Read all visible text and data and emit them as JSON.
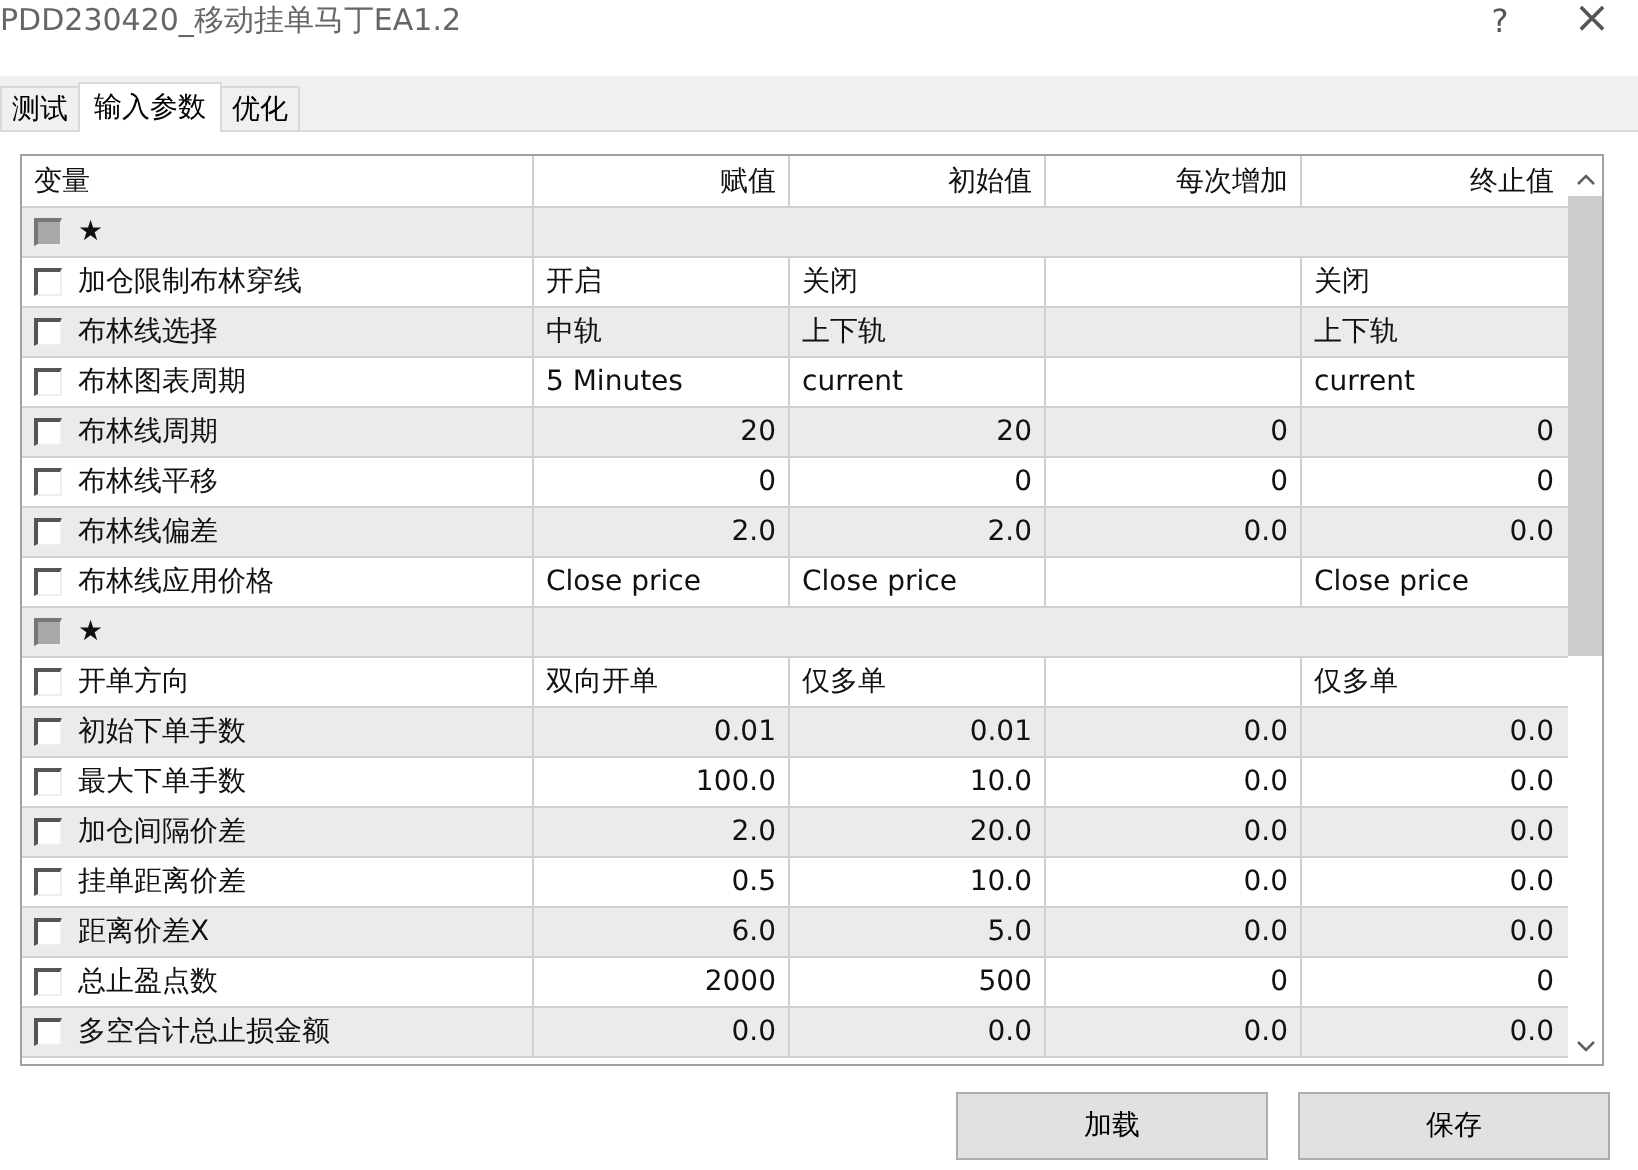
{
  "window": {
    "title": "PDD230420_移动挂单马丁EA1.2",
    "help": "?",
    "close": "×"
  },
  "tabs": [
    {
      "label": "测试",
      "selected": false
    },
    {
      "label": "输入参数",
      "selected": true
    },
    {
      "label": "优化",
      "selected": false
    }
  ],
  "table": {
    "columns": [
      "变量",
      "赋值",
      "初始值",
      "每次增加",
      "终止值"
    ],
    "rows": [
      {
        "kind": "group",
        "checked": false,
        "cells": [
          "★",
          "",
          "",
          "",
          ""
        ]
      },
      {
        "kind": "text",
        "checked": false,
        "cells": [
          "加仓限制布林穿线",
          "开启",
          "关闭",
          "",
          "关闭"
        ]
      },
      {
        "kind": "text",
        "checked": false,
        "cells": [
          "布林线选择",
          "中轨",
          "上下轨",
          "",
          "上下轨"
        ]
      },
      {
        "kind": "text",
        "checked": false,
        "cells": [
          "布林图表周期",
          "5 Minutes",
          "current",
          "",
          "current"
        ]
      },
      {
        "kind": "number",
        "checked": false,
        "cells": [
          "布林线周期",
          "20",
          "20",
          "0",
          "0"
        ]
      },
      {
        "kind": "number",
        "checked": false,
        "cells": [
          "布林线平移",
          "0",
          "0",
          "0",
          "0"
        ]
      },
      {
        "kind": "number",
        "checked": false,
        "cells": [
          "布林线偏差",
          "2.0",
          "2.0",
          "0.0",
          "0.0"
        ]
      },
      {
        "kind": "text",
        "checked": false,
        "cells": [
          "布林线应用价格",
          "Close price",
          "Close price",
          "",
          "Close price"
        ]
      },
      {
        "kind": "group",
        "checked": false,
        "cells": [
          "★",
          "",
          "",
          "",
          ""
        ]
      },
      {
        "kind": "text",
        "checked": false,
        "cells": [
          "开单方向",
          "双向开单",
          "仅多单",
          "",
          "仅多单"
        ]
      },
      {
        "kind": "number",
        "checked": false,
        "cells": [
          "初始下单手数",
          "0.01",
          "0.01",
          "0.0",
          "0.0"
        ]
      },
      {
        "kind": "number",
        "checked": false,
        "cells": [
          "最大下单手数",
          "100.0",
          "10.0",
          "0.0",
          "0.0"
        ]
      },
      {
        "kind": "number",
        "checked": false,
        "cells": [
          "加仓间隔价差",
          "2.0",
          "20.0",
          "0.0",
          "0.0"
        ]
      },
      {
        "kind": "number",
        "checked": false,
        "cells": [
          "挂单距离价差",
          "0.5",
          "10.0",
          "0.0",
          "0.0"
        ]
      },
      {
        "kind": "number",
        "checked": false,
        "cells": [
          "距离价差X",
          "6.0",
          "5.0",
          "0.0",
          "0.0"
        ]
      },
      {
        "kind": "number",
        "checked": false,
        "cells": [
          "总止盈点数",
          "2000",
          "500",
          "0",
          "0"
        ]
      },
      {
        "kind": "number",
        "checked": false,
        "cells": [
          "多空合计总止损金额",
          "0.0",
          "0.0",
          "0.0",
          "0.0"
        ]
      }
    ]
  },
  "buttons": [
    "加载",
    "保存"
  ]
}
